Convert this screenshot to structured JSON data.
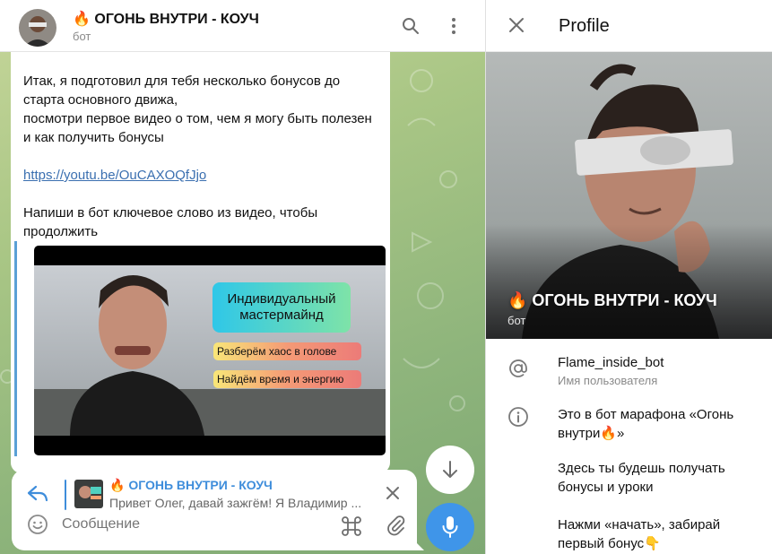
{
  "chat": {
    "title": "🔥 ОГОНЬ ВНУТРИ - КОУЧ",
    "subtitle": "бот",
    "message": {
      "paragraph1": "Итак, я подготовил для тебя несколько бонусов до старта основного движа,\nпосмотри первое видео о том, чем я могу быть полезен и как получить бонусы",
      "link": "https://youtu.be/OuCAXOQfJjo",
      "paragraph2": "Напиши в бот ключевое слово из видео, чтобы продолжить"
    },
    "video": {
      "card_line1": "Индивидуальный",
      "card_line2": "мастермайнд",
      "pill1": "Разберём хаос в голове",
      "pill2": "Найдём время и энергию"
    }
  },
  "composer": {
    "reply_title": "🔥 ОГОНЬ ВНУТРИ - КОУЧ",
    "reply_text": "Привет Олег, давай зажгём! Я Владимир ...",
    "placeholder": "Сообщение"
  },
  "profile": {
    "header_title": "Profile",
    "name": "🔥 ОГОНЬ ВНУТРИ - КОУЧ",
    "subtitle": "бот",
    "username": "Flame_inside_bot",
    "username_caption": "Имя пользователя",
    "bio_1": "Это в бот марафона «Огонь внутри🔥»",
    "bio_2": "Здесь ты будешь получать бонусы и уроки",
    "bio_3": "Нажми «начать», забирай первый бонус👇"
  },
  "icons": {
    "search": "search-icon",
    "more": "more-vertical-icon",
    "close": "close-icon",
    "reply": "reply-icon",
    "emoji": "emoji-icon",
    "command": "command-icon",
    "attach": "paperclip-icon",
    "scroll_down": "arrow-down-icon",
    "mic": "microphone-icon",
    "at": "at-sign-icon",
    "info": "info-icon"
  },
  "colors": {
    "accent": "#3f95e9",
    "link": "#3a6fb0",
    "reply": "#3e8ddb"
  }
}
